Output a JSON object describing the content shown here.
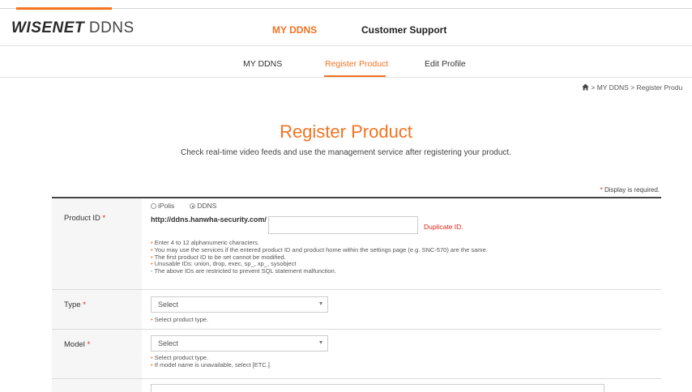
{
  "brand": {
    "logo_bold": "WISENET",
    "logo_light": "DDNS"
  },
  "main_nav": [
    {
      "label": "MY DDNS"
    },
    {
      "label": "Customer Support"
    }
  ],
  "sub_nav": [
    {
      "label": "MY DDNS"
    },
    {
      "label": "Register Product"
    },
    {
      "label": "Edit Profile"
    }
  ],
  "breadcrumb": {
    "items": [
      "MY DDNS",
      "Register Produ"
    ],
    "separator": ">"
  },
  "page": {
    "title": "Register Product",
    "subtitle": "Check real-time video feeds and use the management service after registering your product."
  },
  "required_note": {
    "star": "*",
    "text": "Display is required."
  },
  "form": {
    "product_id": {
      "label": "Product ID",
      "star": "*",
      "radios": [
        {
          "label": "iPolis",
          "selected": false
        },
        {
          "label": "DDNS",
          "selected": true
        }
      ],
      "url_prefix": "http://ddns.hanwha-security.com/",
      "value": "",
      "error": "Duplicate ID.",
      "hints": [
        "Enter 4 to 12 alphanumeric characters.",
        "You may use the services if the entered product ID and product home within the settings page (e.g. SNC-570) are the same.",
        "The first product ID to be set cannot be modified.",
        "Unusable IDs: union, drop, exec, sp_, xp_, sysobject",
        " - The above IDs are restricted to prevent SQL statement malfunction."
      ]
    },
    "type": {
      "label": "Type",
      "star": "*",
      "selected": "Select",
      "hints": [
        "Select product type."
      ]
    },
    "model": {
      "label": "Model",
      "star": "*",
      "selected": "Select",
      "hints": [
        "Select product type.",
        "If model name is unavailable, select [ETC.]."
      ]
    }
  },
  "colors": {
    "accent": "#f37321",
    "required": "#e2231a"
  }
}
